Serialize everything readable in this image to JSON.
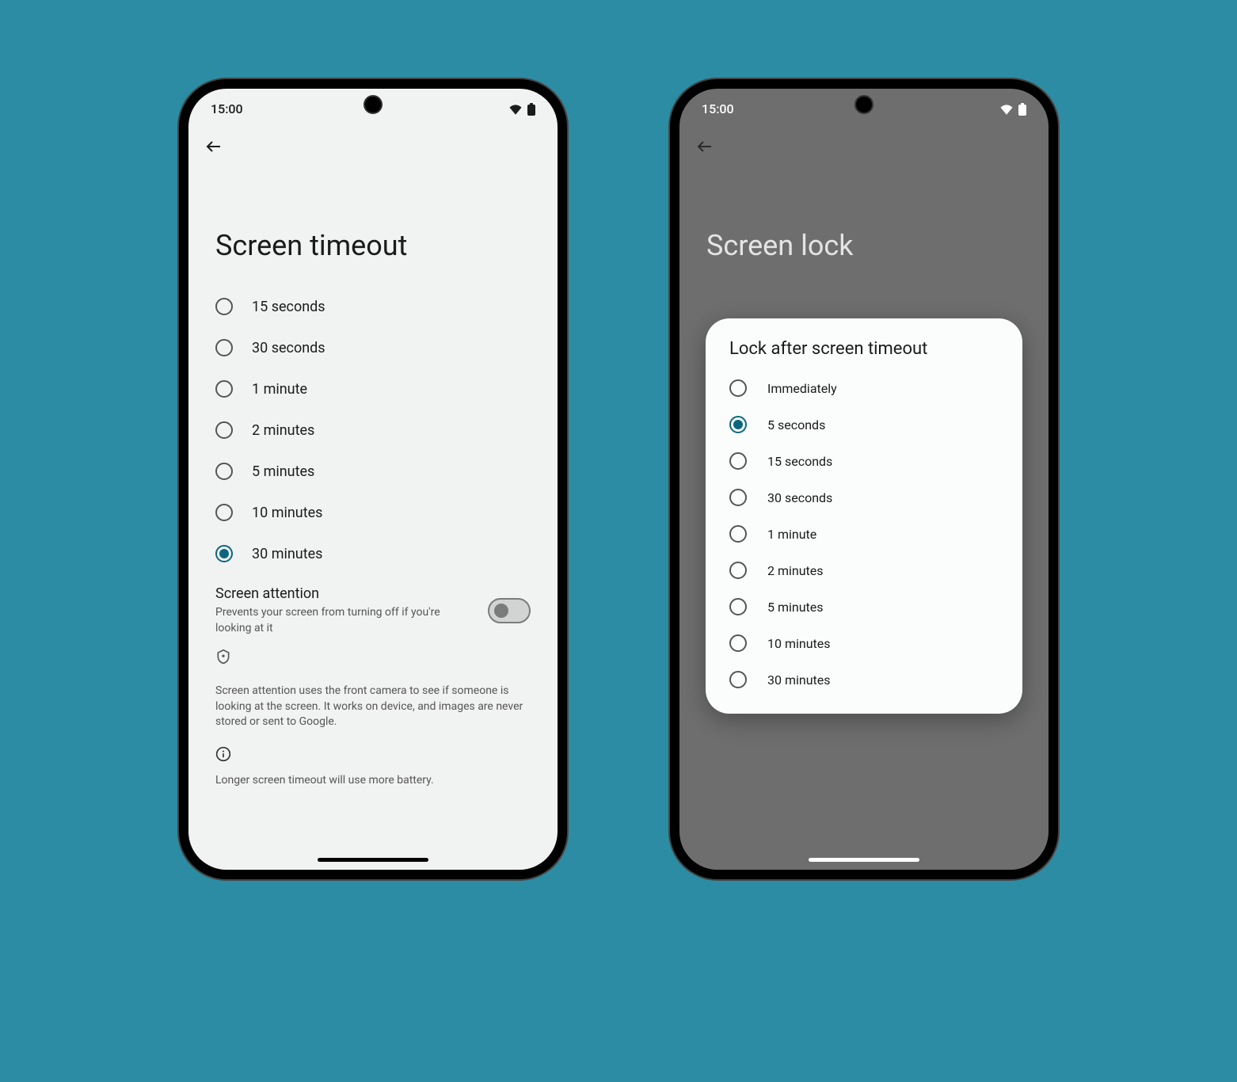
{
  "status_time": "15:00",
  "phone_left": {
    "title": "Screen timeout",
    "options": [
      {
        "label": "15 seconds",
        "selected": false
      },
      {
        "label": "30 seconds",
        "selected": false
      },
      {
        "label": "1 minute",
        "selected": false
      },
      {
        "label": "2 minutes",
        "selected": false
      },
      {
        "label": "5 minutes",
        "selected": false
      },
      {
        "label": "10 minutes",
        "selected": false
      },
      {
        "label": "30 minutes",
        "selected": true
      }
    ],
    "attention_title": "Screen attention",
    "attention_sub": "Prevents your screen from turning off if you're looking at it",
    "attention_toggle": false,
    "privacy_text": "Screen attention uses the front camera to see if someone is looking at the screen. It works on device, and images are never stored or sent to Google.",
    "footer_text": "Longer screen timeout will use more battery."
  },
  "phone_right": {
    "title": "Screen lock",
    "dialog_title": "Lock after screen timeout",
    "options": [
      {
        "label": "Immediately",
        "selected": false
      },
      {
        "label": "5 seconds",
        "selected": true
      },
      {
        "label": "15 seconds",
        "selected": false
      },
      {
        "label": "30 seconds",
        "selected": false
      },
      {
        "label": "1 minute",
        "selected": false
      },
      {
        "label": "2 minutes",
        "selected": false
      },
      {
        "label": "5 minutes",
        "selected": false
      },
      {
        "label": "10 minutes",
        "selected": false
      },
      {
        "label": "30 minutes",
        "selected": false
      }
    ]
  }
}
